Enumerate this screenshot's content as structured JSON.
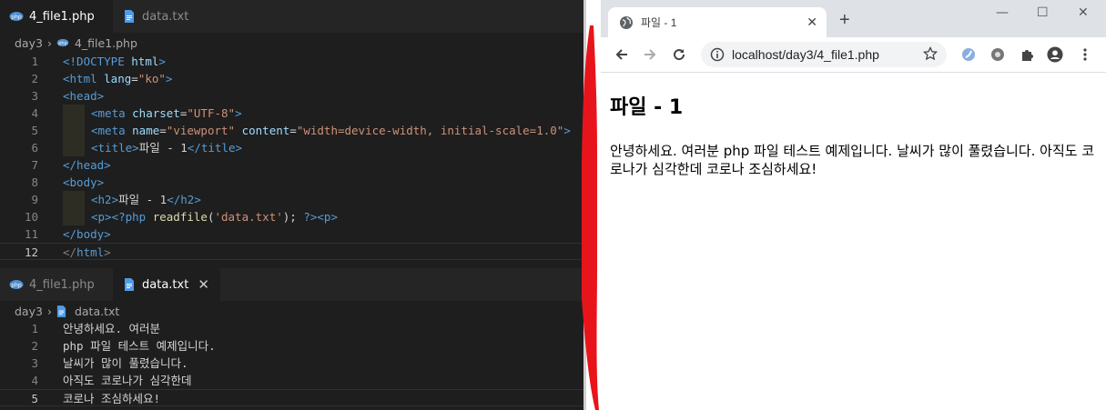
{
  "editor": {
    "top_tabs": [
      {
        "label": "4_file1.php",
        "icon": "php-file-icon",
        "active": true
      },
      {
        "label": "data.txt",
        "icon": "text-file-icon",
        "active": false
      }
    ],
    "top_breadcrumb": {
      "folder": "day3",
      "file": "4_file1.php"
    },
    "php_lines": [
      {
        "n": "1",
        "parts": [
          [
            "t",
            "<!DOCTYPE "
          ],
          [
            "a",
            "html"
          ],
          [
            "t",
            ">"
          ]
        ]
      },
      {
        "n": "2",
        "parts": [
          [
            "t",
            "<html "
          ],
          [
            "a",
            "lang"
          ],
          [
            "d",
            "="
          ],
          [
            "s",
            "\"ko\""
          ],
          [
            "t",
            ">"
          ]
        ]
      },
      {
        "n": "3",
        "parts": [
          [
            "t",
            "<head>"
          ]
        ]
      },
      {
        "n": "4",
        "indent": true,
        "parts": [
          [
            "t",
            "<meta "
          ],
          [
            "a",
            "charset"
          ],
          [
            "d",
            "="
          ],
          [
            "s",
            "\"UTF-8\""
          ],
          [
            "t",
            ">"
          ]
        ]
      },
      {
        "n": "5",
        "indent": true,
        "parts": [
          [
            "t",
            "<meta "
          ],
          [
            "a",
            "name"
          ],
          [
            "d",
            "="
          ],
          [
            "s",
            "\"viewport\""
          ],
          [
            "d",
            " "
          ],
          [
            "a",
            "content"
          ],
          [
            "d",
            "="
          ],
          [
            "s",
            "\"width=device-width, initial-scale=1.0\""
          ],
          [
            "t",
            ">"
          ]
        ]
      },
      {
        "n": "6",
        "indent": true,
        "parts": [
          [
            "t",
            "<title>"
          ],
          [
            "d",
            "파일 - 1"
          ],
          [
            "t",
            "</title>"
          ]
        ]
      },
      {
        "n": "7",
        "parts": [
          [
            "t",
            "</head>"
          ]
        ]
      },
      {
        "n": "8",
        "parts": [
          [
            "t",
            "<body>"
          ]
        ]
      },
      {
        "n": "9",
        "indent": true,
        "parts": [
          [
            "t",
            "<h2>"
          ],
          [
            "d",
            "파일 - 1"
          ],
          [
            "t",
            "</h2>"
          ]
        ]
      },
      {
        "n": "10",
        "indent": true,
        "parts": [
          [
            "t",
            "<p>"
          ],
          [
            "p",
            "<?php "
          ],
          [
            "f",
            "readfile"
          ],
          [
            "d",
            "("
          ],
          [
            "s",
            "'data.txt'"
          ],
          [
            "d",
            "); "
          ],
          [
            "p",
            "?>"
          ],
          [
            "t",
            "<p>"
          ]
        ]
      },
      {
        "n": "11",
        "parts": [
          [
            "t",
            "</body>"
          ]
        ]
      },
      {
        "n": "12",
        "current": true,
        "parts": [
          [
            "g",
            "</"
          ],
          [
            "t",
            "html"
          ],
          [
            "g",
            ">"
          ]
        ]
      }
    ],
    "bottom_tabs": [
      {
        "label": "4_file1.php",
        "icon": "php-file-icon",
        "active": false
      },
      {
        "label": "data.txt",
        "icon": "text-file-icon",
        "active": true,
        "close": "✕"
      }
    ],
    "bottom_breadcrumb": {
      "folder": "day3",
      "file": "data.txt"
    },
    "txt_lines": [
      {
        "n": "1",
        "text": "안녕하세요. 여러분"
      },
      {
        "n": "2",
        "text": "php 파일 테스트 예제입니다."
      },
      {
        "n": "3",
        "text": "날씨가 많이 풀렸습니다."
      },
      {
        "n": "4",
        "text": "아직도 코로나가 심각한데"
      },
      {
        "n": "5",
        "text": "코로나 조심하세요!",
        "current": true
      }
    ]
  },
  "browser": {
    "tab_title": "파일 - 1",
    "tab_close": "✕",
    "new_tab": "+",
    "window_controls": {
      "minimize": "—",
      "maximize": "☐",
      "close": "✕"
    },
    "url": "localhost/day3/4_file1.php",
    "page": {
      "heading": "파일 - 1",
      "paragraph": "안녕하세요. 여러분 php 파일 테스트 예제입니다. 날씨가 많이 풀렸습니다. 아직도 코로나가 심각한데 코로나 조심하세요!"
    }
  },
  "colors": {
    "annotation_red": "#e8141c",
    "editor_bg": "#1e1e1e",
    "tag_blue": "#569cd6",
    "string_orange": "#ce9178"
  }
}
